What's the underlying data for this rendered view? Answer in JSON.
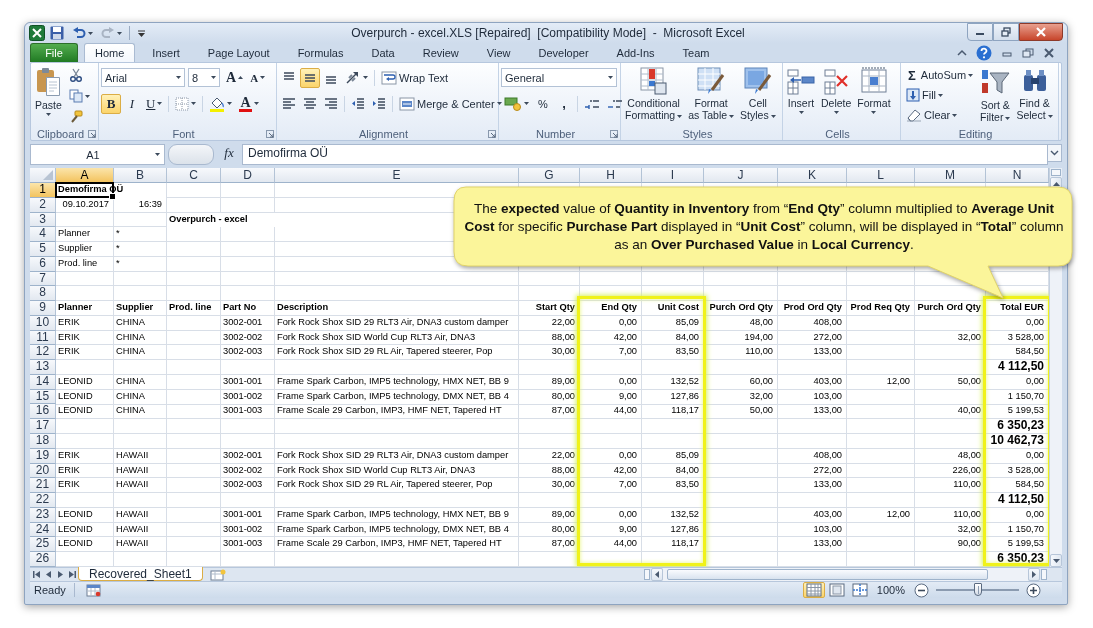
{
  "window": {
    "title": "Overpurch - excel.XLS [Repaired]  [Compatibility Mode]  -  Microsoft Excel"
  },
  "ribbon": {
    "tabs": [
      {
        "label": "File",
        "kind": "file",
        "selected": false
      },
      {
        "label": "Home",
        "kind": "tab",
        "selected": true
      },
      {
        "label": "Insert",
        "kind": "tab",
        "selected": false
      },
      {
        "label": "Page Layout",
        "kind": "tab",
        "selected": false
      },
      {
        "label": "Formulas",
        "kind": "tab",
        "selected": false
      },
      {
        "label": "Data",
        "kind": "tab",
        "selected": false
      },
      {
        "label": "Review",
        "kind": "tab",
        "selected": false
      },
      {
        "label": "View",
        "kind": "tab",
        "selected": false
      },
      {
        "label": "Developer",
        "kind": "tab",
        "selected": false
      },
      {
        "label": "Add-Ins",
        "kind": "tab",
        "selected": false
      },
      {
        "label": "Team",
        "kind": "tab",
        "selected": false
      }
    ],
    "groups": [
      {
        "kind": "clipboard",
        "name": "Clipboard",
        "launcher": true,
        "paste": "Paste"
      },
      {
        "kind": "font",
        "name": "Font",
        "launcher": true,
        "font": "Arial",
        "size": "8",
        "grow": "A",
        "shrink": "A",
        "bold": {
          "label": "B",
          "on": true
        },
        "italic": {
          "label": "I",
          "on": false
        },
        "underline": {
          "label": "U",
          "on": false
        },
        "font_color": "A"
      },
      {
        "kind": "alignment",
        "name": "Alignment",
        "launcher": true,
        "align_top": {
          "on": false
        },
        "align_middle": {
          "on": true
        },
        "align_bottom": {
          "on": false
        },
        "align_left": {
          "on": false
        },
        "align_center": {
          "on": false
        },
        "align_right": {
          "on": false
        },
        "wrap_text": "Wrap Text",
        "merge": "Merge & Center"
      },
      {
        "kind": "number",
        "name": "Number",
        "launcher": true,
        "format": "General",
        "percent": "%",
        "comma": ","
      },
      {
        "kind": "styles",
        "name": "Styles",
        "buttons": [
          "Conditional\nFormatting",
          "Format\nas Table",
          "Cell\nStyles"
        ]
      },
      {
        "kind": "cells",
        "name": "Cells",
        "buttons": [
          "Insert",
          "Delete",
          "Format"
        ]
      },
      {
        "kind": "editing",
        "name": "Editing",
        "autosum": {
          "glyph": "Σ",
          "label": "AutoSum"
        },
        "fill": "Fill",
        "clear": "Clear",
        "buttons": [
          "Sort &\nFilter",
          "Find &\nSelect"
        ]
      }
    ]
  },
  "formula_bar": {
    "name_box": "A1",
    "function_label": "fx",
    "value": "Demofirma OÜ"
  },
  "sheet": {
    "columns": [
      {
        "letter": "A",
        "selected": true,
        "highlighted": false
      },
      {
        "letter": "B",
        "selected": false,
        "highlighted": false
      },
      {
        "letter": "C",
        "selected": false,
        "highlighted": false
      },
      {
        "letter": "D",
        "selected": false,
        "highlighted": false
      },
      {
        "letter": "E",
        "selected": false,
        "highlighted": false
      },
      {
        "letter": "G",
        "selected": false,
        "highlighted": false
      },
      {
        "letter": "H",
        "selected": false,
        "highlighted": true
      },
      {
        "letter": "I",
        "selected": false,
        "highlighted": true
      },
      {
        "letter": "J",
        "selected": false,
        "highlighted": false
      },
      {
        "letter": "K",
        "selected": false,
        "highlighted": false
      },
      {
        "letter": "L",
        "selected": false,
        "highlighted": false
      },
      {
        "letter": "M",
        "selected": false,
        "highlighted": false
      },
      {
        "letter": "N",
        "selected": false,
        "highlighted": true
      }
    ],
    "rows": [
      {
        "number": "1",
        "kind": "title",
        "selected": true,
        "cells": [
          "Demofirma OÜ",
          null,
          null,
          null,
          null,
          null,
          null,
          null,
          null,
          null,
          null,
          null,
          null
        ]
      },
      {
        "number": "2",
        "kind": "date",
        "selected": false,
        "cells": [
          "09.10.2017",
          "16:39",
          null,
          null,
          null,
          null,
          null,
          null,
          null,
          null,
          null,
          null,
          null
        ]
      },
      {
        "number": "3",
        "kind": "title",
        "selected": false,
        "cells": [
          null,
          null,
          "Overpurch - excel",
          null,
          null,
          null,
          null,
          null,
          null,
          null,
          null,
          null,
          null
        ]
      },
      {
        "number": "4",
        "kind": "info",
        "selected": false,
        "cells": [
          "Planner",
          "*",
          null,
          null,
          null,
          null,
          null,
          null,
          null,
          null,
          null,
          null,
          null
        ]
      },
      {
        "number": "5",
        "kind": "info",
        "selected": false,
        "cells": [
          "Supplier",
          "*",
          null,
          null,
          null,
          null,
          null,
          null,
          null,
          null,
          null,
          null,
          null
        ]
      },
      {
        "number": "6",
        "kind": "info",
        "selected": false,
        "cells": [
          "Prod. line",
          "*",
          null,
          null,
          null,
          null,
          null,
          null,
          null,
          null,
          null,
          null,
          null
        ]
      },
      {
        "number": "7",
        "kind": "blank",
        "selected": false
      },
      {
        "number": "8",
        "kind": "blank",
        "selected": false
      },
      {
        "number": "9",
        "kind": "header",
        "selected": false,
        "cells": [
          "Planner",
          "Supplier",
          "Prod. line",
          "Part No",
          "Description",
          "Start Qty",
          "End Qty",
          "Unit Cost",
          "Purch Ord Qty",
          "Prod Ord Qty",
          "Prod Req Qty",
          "Purch Ord Qty",
          "Total EUR"
        ]
      },
      {
        "number": "10",
        "kind": "data",
        "selected": false,
        "cells": [
          "ERIK",
          "CHINA",
          null,
          "3002-001",
          "Fork Rock Shox SID 29 RLT3 Air, DNA3 custom damper",
          "22,00",
          "0,00",
          "85,09",
          "48,00",
          "408,00",
          null,
          null,
          "0,00"
        ]
      },
      {
        "number": "11",
        "kind": "data",
        "selected": false,
        "cells": [
          "ERIK",
          "CHINA",
          null,
          "3002-002",
          "Fork Rock Shox SID World Cup RLT3 Air, DNA3",
          "88,00",
          "42,00",
          "84,00",
          "194,00",
          "272,00",
          null,
          "32,00",
          "3 528,00"
        ]
      },
      {
        "number": "12",
        "kind": "data",
        "selected": false,
        "cells": [
          "ERIK",
          "CHINA",
          null,
          "3002-003",
          "Fork Rock Shox SID 29 RL Air, Tapered steerer, Pop",
          "30,00",
          "7,00",
          "83,50",
          "110,00",
          "133,00",
          null,
          null,
          "584,50"
        ]
      },
      {
        "number": "13",
        "kind": "total",
        "selected": false,
        "cells": [
          null,
          null,
          null,
          null,
          null,
          null,
          null,
          null,
          null,
          null,
          null,
          null,
          "4 112,50"
        ]
      },
      {
        "number": "14",
        "kind": "data",
        "selected": false,
        "cells": [
          "LEONID",
          "CHINA",
          null,
          "3001-001",
          "Frame Spark Carbon, IMP5 technology, HMX NET, BB 9",
          "89,00",
          "0,00",
          "132,52",
          "60,00",
          "403,00",
          "12,00",
          "50,00",
          "0,00"
        ]
      },
      {
        "number": "15",
        "kind": "data",
        "selected": false,
        "cells": [
          "LEONID",
          "CHINA",
          null,
          "3001-002",
          "Frame Spark Carbon, IMP5 technology, DMX NET, BB 4",
          "80,00",
          "9,00",
          "127,86",
          "32,00",
          "103,00",
          null,
          null,
          "1 150,70"
        ]
      },
      {
        "number": "16",
        "kind": "data",
        "selected": false,
        "cells": [
          "LEONID",
          "CHINA",
          null,
          "3001-003",
          "Frame Scale 29 Carbon, IMP3, HMF NET, Tapered HT",
          "87,00",
          "44,00",
          "118,17",
          "50,00",
          "133,00",
          null,
          "40,00",
          "5 199,53"
        ]
      },
      {
        "number": "17",
        "kind": "total",
        "selected": false,
        "cells": [
          null,
          null,
          null,
          null,
          null,
          null,
          null,
          null,
          null,
          null,
          null,
          null,
          "6 350,23"
        ]
      },
      {
        "number": "18",
        "kind": "total",
        "selected": false,
        "cells": [
          null,
          null,
          null,
          null,
          null,
          null,
          null,
          null,
          null,
          null,
          null,
          null,
          "10 462,73"
        ]
      },
      {
        "number": "19",
        "kind": "data",
        "selected": false,
        "cells": [
          "ERIK",
          "HAWAII",
          null,
          "3002-001",
          "Fork Rock Shox SID 29 RLT3 Air, DNA3 custom damper",
          "22,00",
          "0,00",
          "85,09",
          null,
          "408,00",
          null,
          "48,00",
          "0,00"
        ]
      },
      {
        "number": "20",
        "kind": "data",
        "selected": false,
        "cells": [
          "ERIK",
          "HAWAII",
          null,
          "3002-002",
          "Fork Rock Shox SID World Cup RLT3 Air, DNA3",
          "88,00",
          "42,00",
          "84,00",
          null,
          "272,00",
          null,
          "226,00",
          "3 528,00"
        ]
      },
      {
        "number": "21",
        "kind": "data",
        "selected": false,
        "cells": [
          "ERIK",
          "HAWAII",
          null,
          "3002-003",
          "Fork Rock Shox SID 29 RL Air, Tapered steerer, Pop",
          "30,00",
          "7,00",
          "83,50",
          null,
          "133,00",
          null,
          "110,00",
          "584,50"
        ]
      },
      {
        "number": "22",
        "kind": "total",
        "selected": false,
        "cells": [
          null,
          null,
          null,
          null,
          null,
          null,
          null,
          null,
          null,
          null,
          null,
          null,
          "4 112,50"
        ]
      },
      {
        "number": "23",
        "kind": "data",
        "selected": false,
        "cells": [
          "LEONID",
          "HAWAII",
          null,
          "3001-001",
          "Frame Spark Carbon, IMP5 technology, HMX NET, BB 9",
          "89,00",
          "0,00",
          "132,52",
          null,
          "403,00",
          "12,00",
          "110,00",
          "0,00"
        ]
      },
      {
        "number": "24",
        "kind": "data",
        "selected": false,
        "cells": [
          "LEONID",
          "HAWAII",
          null,
          "3001-002",
          "Frame Spark Carbon, IMP5 technology, DMX NET, BB 4",
          "80,00",
          "9,00",
          "127,86",
          null,
          "103,00",
          null,
          "32,00",
          "1 150,70"
        ]
      },
      {
        "number": "25",
        "kind": "data",
        "selected": false,
        "cells": [
          "LEONID",
          "HAWAII",
          null,
          "3001-003",
          "Frame Scale 29 Carbon, IMP3, HMF NET, Tapered HT",
          "87,00",
          "44,00",
          "118,17",
          null,
          "133,00",
          null,
          "90,00",
          "5 199,53"
        ]
      },
      {
        "number": "26",
        "kind": "total",
        "selected": false,
        "cells": [
          null,
          null,
          null,
          null,
          null,
          null,
          null,
          null,
          null,
          null,
          null,
          null,
          "6 350,23"
        ]
      }
    ]
  },
  "sheet_tabs": [
    {
      "label": "Recovered_Sheet1",
      "selected": true
    }
  ],
  "status_bar": {
    "text": "Ready",
    "views": [
      {
        "selected": true
      },
      {
        "selected": false
      },
      {
        "selected": false
      }
    ],
    "zoom": "100%",
    "zoom_slider": {
      "level": 0.5
    }
  },
  "callout": {
    "text": "The **expected** value of **Quantity in Inventory** from “**End Qty**” column multiplied to **Average Unit Cost** for specific **Purchase Part** displayed in “**Unit Cost**” column, will be displayed in “**Total**” column as an **Over Purchased Value** in **Local Currency**."
  }
}
